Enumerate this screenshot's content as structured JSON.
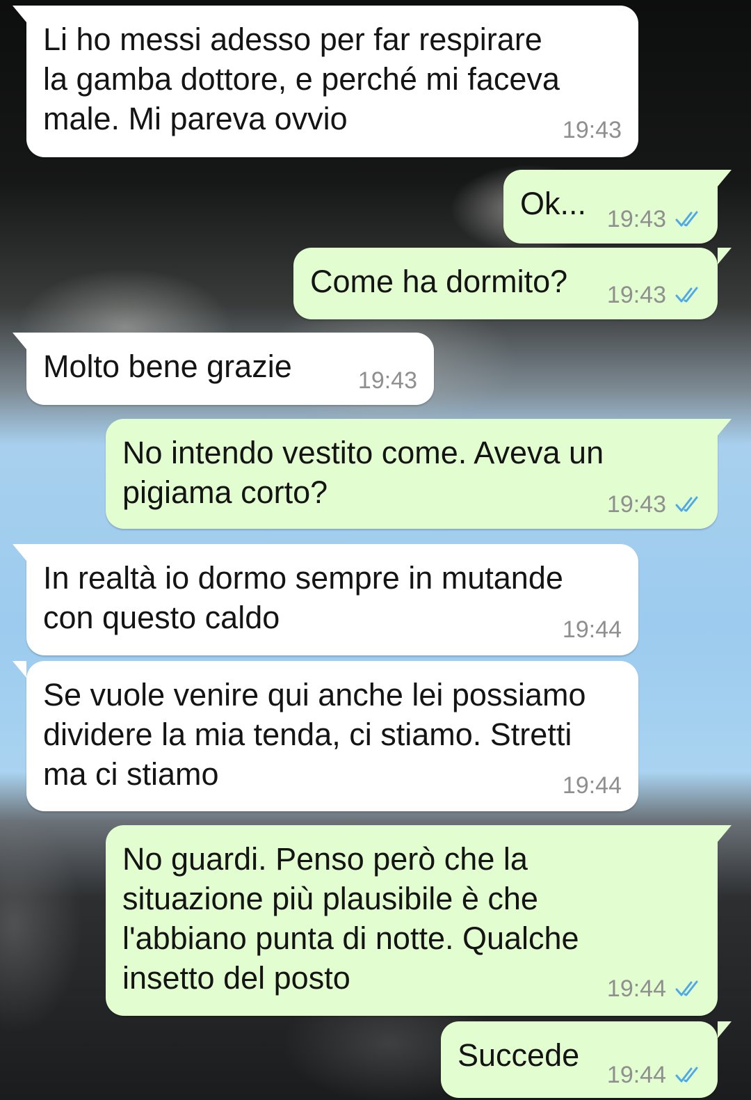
{
  "accent": {
    "incoming_bubble": "#ffffff",
    "outgoing_bubble": "#e2fdcf",
    "read_check": "#4fa9e6",
    "time_text": "#8f8f8f"
  },
  "messages": [
    {
      "direction": "incoming",
      "text": "Li ho messi adesso per far respirare\nla gamba dottore, e perché mi faceva\nmale. Mi pareva ovvio",
      "time": "19:43"
    },
    {
      "direction": "outgoing",
      "text": "Ok...",
      "time": "19:43",
      "status_icon": "double-check-read-icon"
    },
    {
      "direction": "outgoing",
      "text": "Come ha dormito?",
      "time": "19:43",
      "status_icon": "double-check-read-icon"
    },
    {
      "direction": "incoming",
      "text": "Molto bene grazie",
      "time": "19:43"
    },
    {
      "direction": "outgoing",
      "text": "No intendo vestito come. Aveva un\npigiama corto?",
      "time": "19:43",
      "status_icon": "double-check-read-icon"
    },
    {
      "direction": "incoming",
      "text": "In realtà io dormo sempre in mutande\ncon questo caldo",
      "time": "19:44"
    },
    {
      "direction": "incoming",
      "text": "Se vuole venire qui anche lei possiamo\ndividere la mia tenda, ci stiamo. Stretti\nma ci stiamo",
      "time": "19:44"
    },
    {
      "direction": "outgoing",
      "text": "No guardi. Penso però che la\nsituazione più plausibile è che\nl'abbiano punta di notte. Qualche\ninsetto del posto",
      "time": "19:44",
      "status_icon": "double-check-read-icon"
    },
    {
      "direction": "outgoing",
      "text": "Succede",
      "time": "19:44",
      "status_icon": "double-check-read-icon"
    }
  ]
}
